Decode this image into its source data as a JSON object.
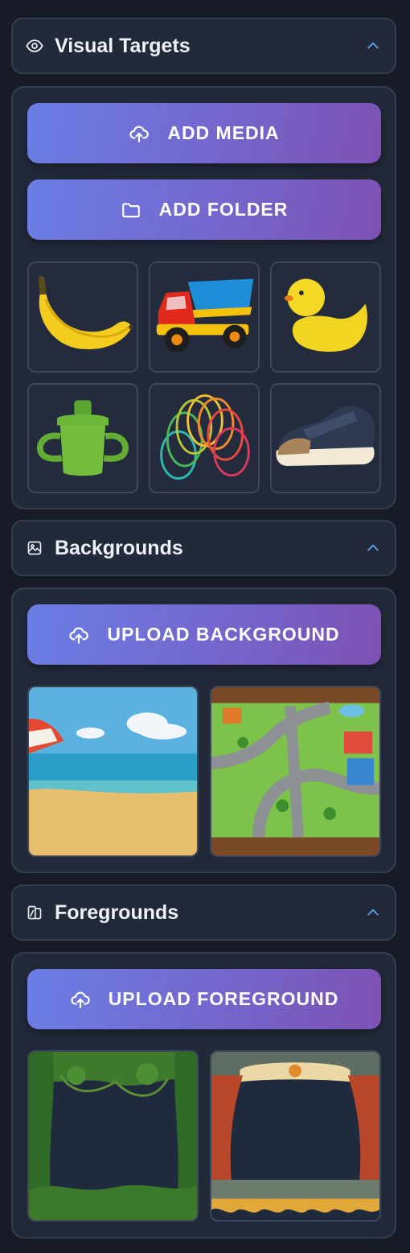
{
  "visual_targets": {
    "title": "Visual Targets",
    "icon": "eye-icon",
    "add_media_label": "ADD MEDIA",
    "add_folder_label": "ADD FOLDER",
    "items": [
      "banana",
      "toy-dump-truck",
      "rubber-duck",
      "sippy-cup",
      "rainbow-slinky",
      "sneaker"
    ]
  },
  "backgrounds": {
    "title": "Backgrounds",
    "icon": "image-icon",
    "upload_label": "UPLOAD BACKGROUND",
    "items": [
      "beach",
      "play-mat-town"
    ]
  },
  "foregrounds": {
    "title": "Foregrounds",
    "icon": "layers-icon",
    "upload_label": "UPLOAD FOREGROUND",
    "items": [
      "jungle-frame",
      "puppet-theater"
    ]
  },
  "colors": {
    "page_bg": "#171b25",
    "panel_bg": "#222939",
    "panel_border": "#343c4f",
    "button_gradient_start": "#6a7ee5",
    "button_gradient_end": "#7d52b3",
    "chevron": "#5aa0f0"
  }
}
